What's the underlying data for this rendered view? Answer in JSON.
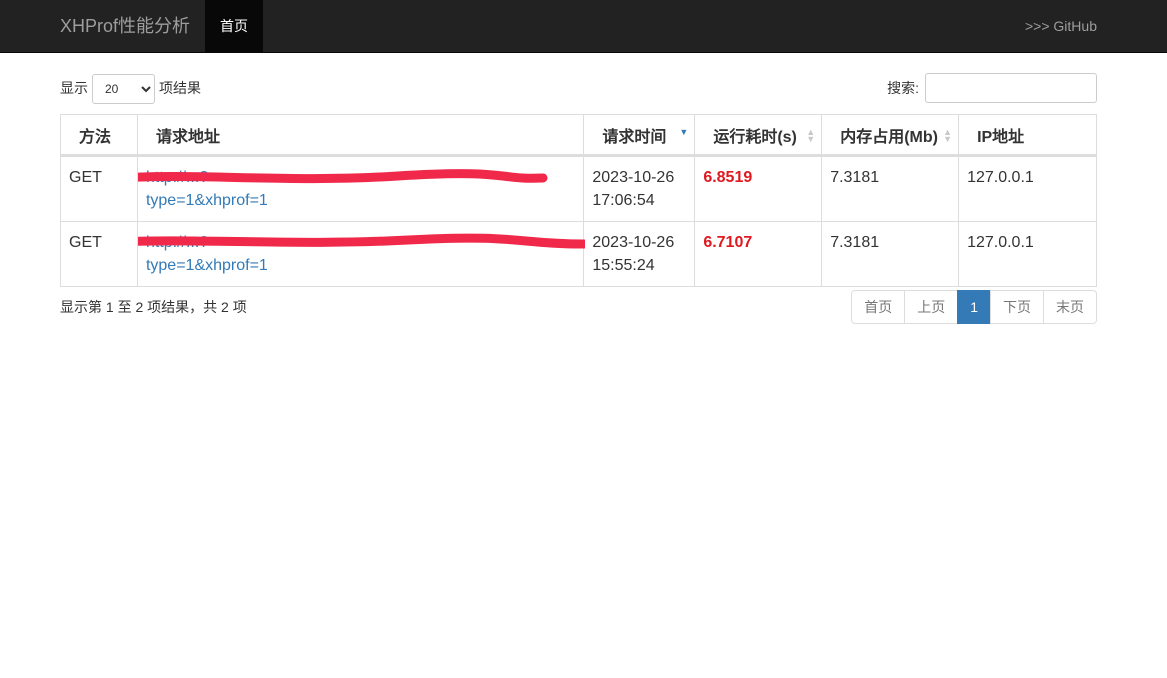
{
  "nav": {
    "brand": "XHProf性能分析",
    "home": "首页",
    "github": ">>> GitHub"
  },
  "controls": {
    "show_label": "显示",
    "page_size": "20",
    "page_size_options": [
      "20"
    ],
    "results_label": "项结果",
    "search_label": "搜索:",
    "search_value": ""
  },
  "table": {
    "headers": [
      "方法",
      "请求地址",
      "请求时间",
      "运行耗时(s)",
      "内存占用(Mb)",
      "IP地址"
    ],
    "rows": [
      {
        "method": "GET",
        "url_line1": "http://...?",
        "url_line2": "type=1&xhprof=1",
        "date": "2023-10-26",
        "time": "17:06:54",
        "runtime": "6.8519",
        "memory": "7.3181",
        "ip": "127.0.0.1"
      },
      {
        "method": "GET",
        "url_line1": "http://...?",
        "url_line2": "type=1&xhprof=1",
        "date": "2023-10-26",
        "time": "15:55:24",
        "runtime": "6.7107",
        "memory": "7.3181",
        "ip": "127.0.0.1"
      }
    ]
  },
  "info": "显示第 1 至 2 项结果，共 2 项",
  "pager": {
    "first": "首页",
    "prev": "上页",
    "current": "1",
    "next": "下页",
    "last": "末页"
  },
  "colors": {
    "accent": "#337ab7",
    "runtime_highlight": "#e0181f",
    "redaction": "#f0284a"
  }
}
